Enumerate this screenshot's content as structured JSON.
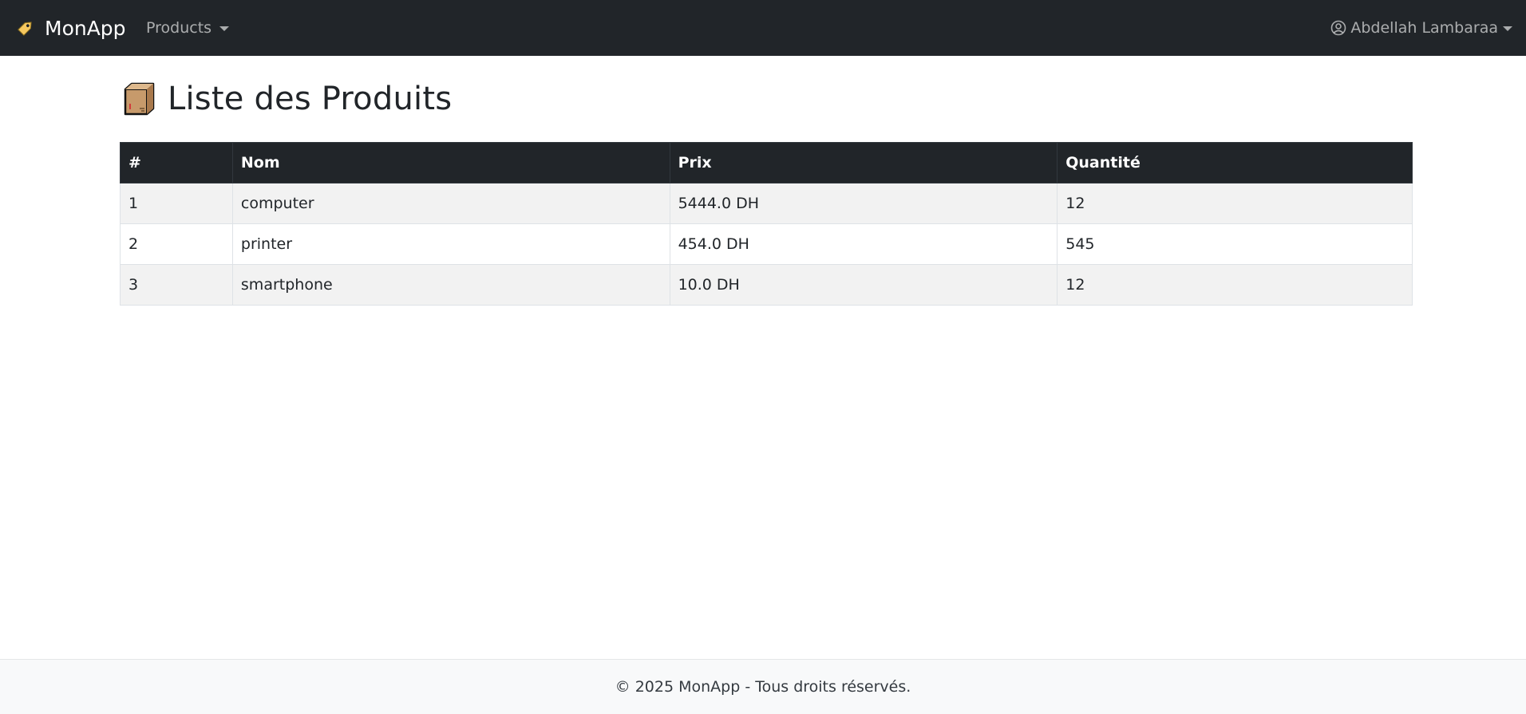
{
  "navbar": {
    "brand": {
      "icon": "price-tag-icon",
      "label": "MonApp"
    },
    "products_menu": {
      "label": "Products",
      "icon": "caret-down-icon"
    },
    "user_menu": {
      "icon": "user-circle-icon",
      "label": "Abdellah Lambaraa",
      "caret_icon": "caret-down-icon"
    }
  },
  "page": {
    "icon": "package-box-icon",
    "title": "Liste des Produits"
  },
  "table": {
    "columns": [
      "#",
      "Nom",
      "Prix",
      "Quantité"
    ],
    "rows": [
      {
        "id": "1",
        "nom": "computer",
        "prix": "5444.0 DH",
        "quantite": "12"
      },
      {
        "id": "2",
        "nom": "printer",
        "prix": "454.0 DH",
        "quantite": "545"
      },
      {
        "id": "3",
        "nom": "smartphone",
        "prix": "10.0 DH",
        "quantite": "12"
      }
    ]
  },
  "footer": {
    "text": "© 2025 MonApp - Tous droits réservés."
  },
  "colors": {
    "navbar_bg": "#212529",
    "table_header_bg": "#212529",
    "striped_row_bg": "#f2f2f2",
    "footer_bg": "#f8f9fa"
  }
}
